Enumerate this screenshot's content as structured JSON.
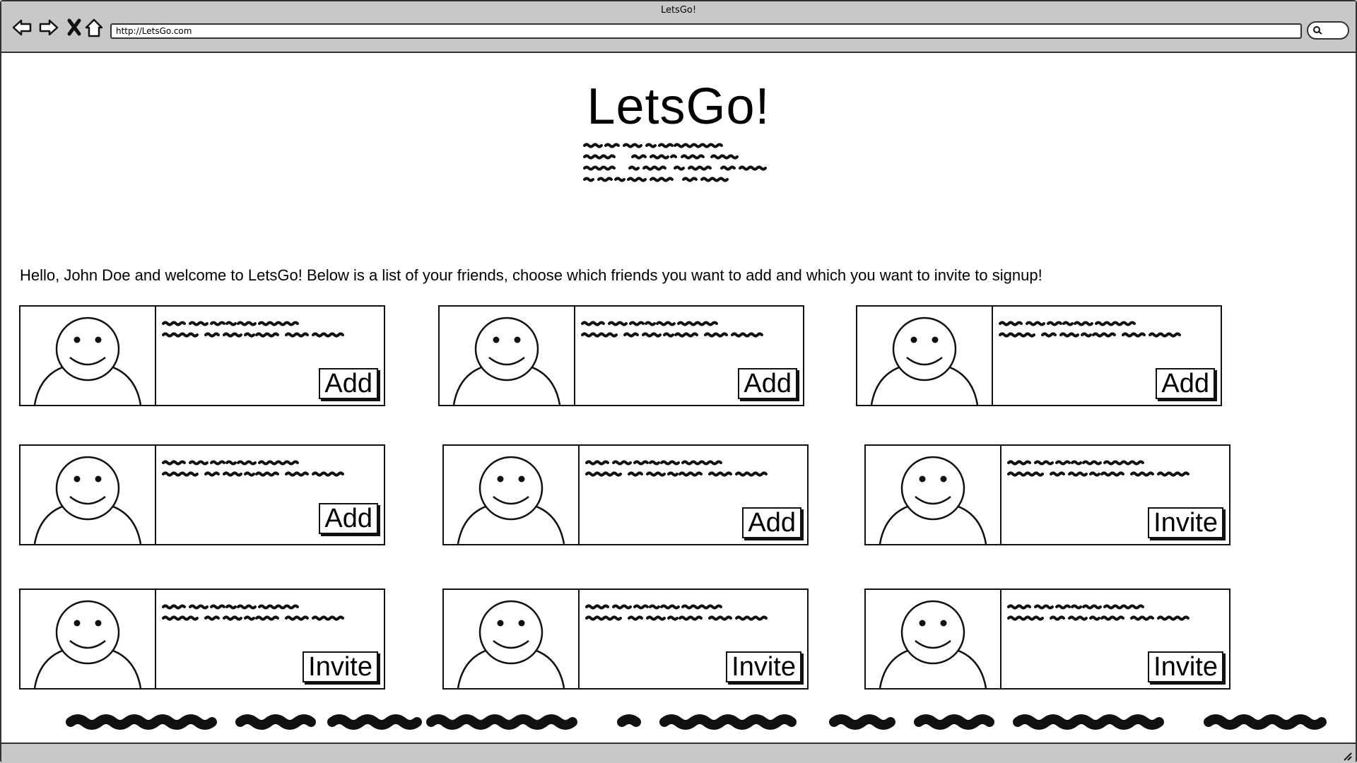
{
  "browser": {
    "window_title": "LetsGo!",
    "url": "http://LetsGo.com",
    "icons": [
      "back-arrow-icon",
      "forward-arrow-icon",
      "close-icon",
      "home-icon",
      "search-icon"
    ]
  },
  "header": {
    "logo": "LetsGo!"
  },
  "welcome": {
    "text": "Hello, John Doe and welcome to LetsGo! Below is a list of your friends, choose which friends you want to add and which you want to invite to signup!"
  },
  "friends": [
    {
      "action": "Add"
    },
    {
      "action": "Add"
    },
    {
      "action": "Add"
    },
    {
      "action": "Add"
    },
    {
      "action": "Add"
    },
    {
      "action": "Invite"
    },
    {
      "action": "Invite"
    },
    {
      "action": "Invite"
    },
    {
      "action": "Invite"
    }
  ]
}
